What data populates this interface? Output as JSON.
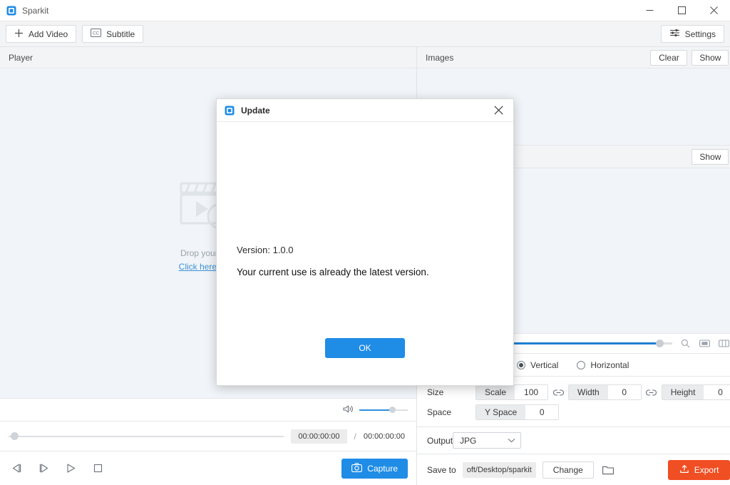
{
  "window": {
    "title": "Sparkit",
    "app_icon": "sparkit-logo-icon",
    "minimize_label": "Minimize",
    "maximize_label": "Maximize",
    "close_label": "Close"
  },
  "toolbar": {
    "add_video_label": "Add Video",
    "add_video_icon": "plus-icon",
    "subtitle_label": "Subtitle",
    "subtitle_icon": "cc-icon",
    "settings_label": "Settings",
    "settings_icon": "sliders-icon"
  },
  "player": {
    "header_title": "Player",
    "drop_text": "Drop your vide",
    "drop_link": "Click here to im",
    "placeholder_icon": "video-clapperboard-icon",
    "volume_icon": "speaker-icon",
    "seek": {
      "current_time": "00:00:00:00",
      "separator": "/",
      "total_time": "00:00:00:00"
    },
    "transport": [
      {
        "name": "step-back-icon",
        "label": "Previous frame"
      },
      {
        "name": "step-forward-icon",
        "label": "Next frame"
      },
      {
        "name": "play-icon",
        "label": "Play"
      },
      {
        "name": "stop-icon",
        "label": "Stop"
      }
    ],
    "capture_label": "Capture",
    "capture_icon": "camera-icon"
  },
  "images": {
    "header_title": "Images",
    "clear_label": "Clear",
    "show_label": "Show"
  },
  "preview": {
    "show_label": "Show",
    "zoom_icon": "magnifier-icon",
    "fit_icon": "fit-screen-icon",
    "split_icon": "split-view-icon"
  },
  "orientation": {
    "vertical_label": "Vertical",
    "horizontal_label": "Horizontal",
    "selected": "Vertical"
  },
  "settings_form": {
    "size_label": "Size",
    "scale_key": "Scale",
    "scale_value": "100",
    "width_key": "Width",
    "width_value": "0",
    "height_key": "Height",
    "height_value": "0",
    "link_icon": "link-icon",
    "space_label": "Space",
    "yspace_key": "Y Space",
    "yspace_value": "0"
  },
  "output": {
    "label": "Output",
    "format": "JPG",
    "chevron_icon": "chevron-down-icon"
  },
  "save": {
    "label": "Save to",
    "path": "oft/Desktop/sparkit",
    "change_label": "Change",
    "folder_icon": "folder-icon",
    "export_label": "Export",
    "export_icon": "upload-icon"
  },
  "dialog": {
    "title": "Update",
    "icon": "sparkit-logo-icon",
    "close_icon": "close-icon",
    "version_text": "Version: 1.0.0",
    "message": "Your current use is already the latest version.",
    "ok_label": "OK"
  },
  "colors": {
    "accent_blue": "#1f8ce6",
    "export_orange": "#f04e23",
    "panel_bg": "#f1f5f9",
    "toolbar_bg": "#f3f4f6",
    "link_blue": "#3b8fd6"
  }
}
